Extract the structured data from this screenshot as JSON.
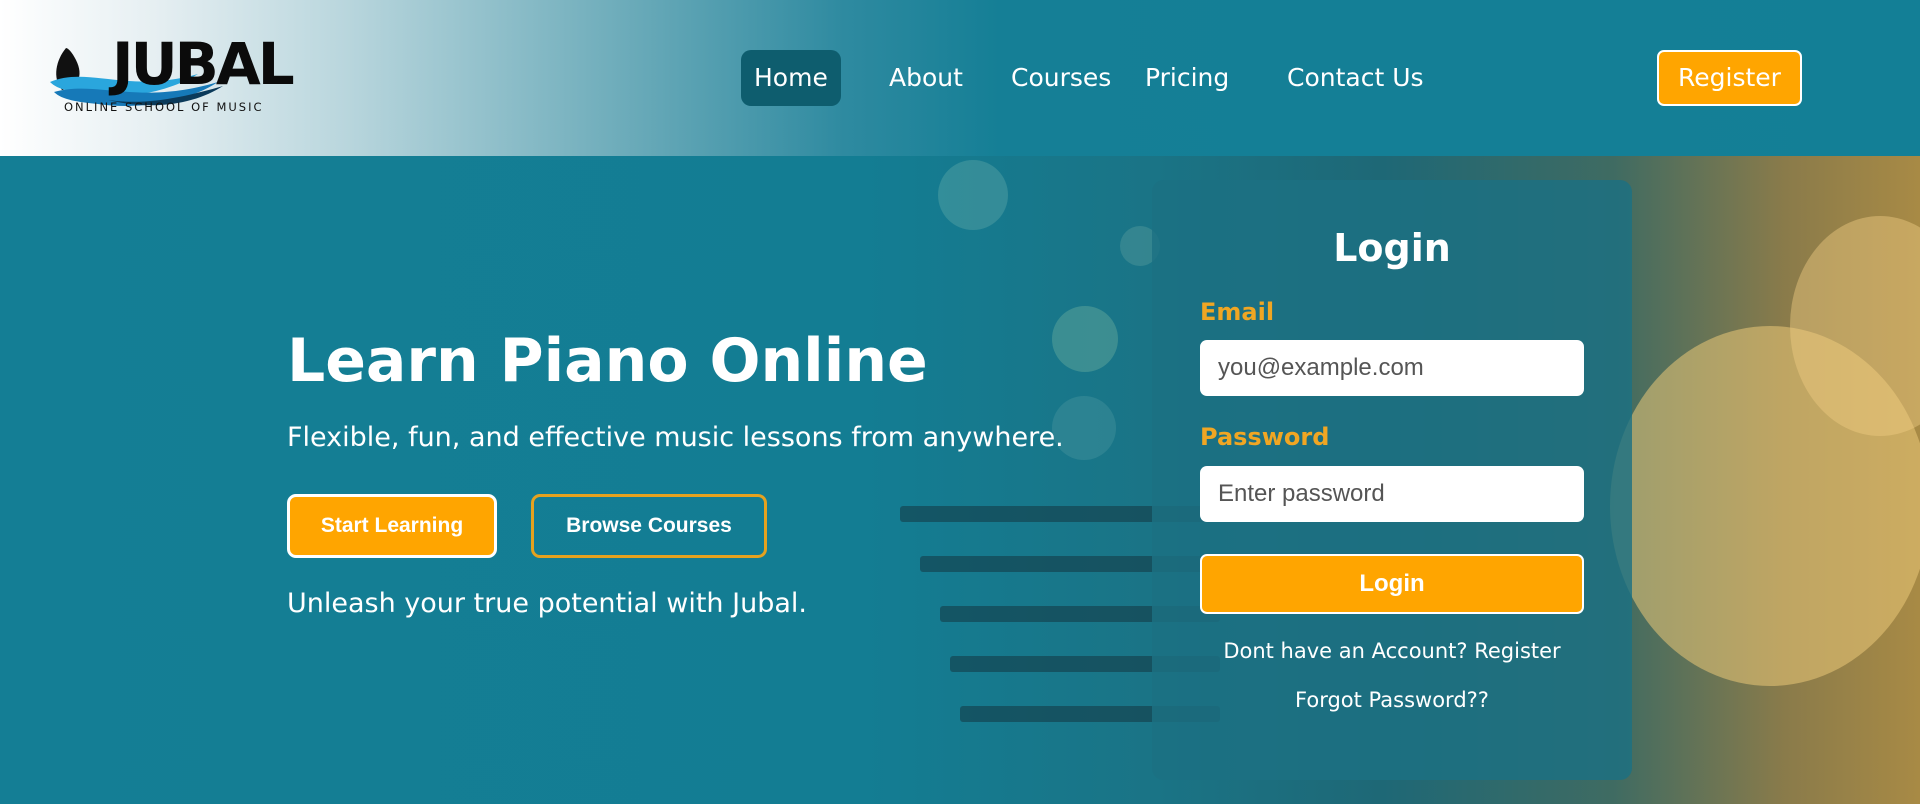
{
  "brand": {
    "name": "JUBAL",
    "tagline": "ONLINE SCHOOL OF MUSIC"
  },
  "nav": {
    "items": [
      {
        "label": "Home"
      },
      {
        "label": "About"
      },
      {
        "label": "Courses"
      },
      {
        "label": "Pricing"
      },
      {
        "label": "Contact Us"
      }
    ],
    "register_label": "Register"
  },
  "hero": {
    "title": "Learn Piano Online",
    "subtitle": "Flexible, fun, and effective music lessons from anywhere.",
    "start_label": "Start Learning",
    "browse_label": "Browse Courses",
    "tagline": "Unleash your true potential with Jubal."
  },
  "login": {
    "title": "Login",
    "email_label": "Email",
    "email_placeholder": "you@example.com",
    "password_label": "Password",
    "password_placeholder": "Enter password",
    "submit_label": "Login",
    "register_link": "Dont have an Account? Register",
    "forgot_link": "Forgot Password??"
  },
  "colors": {
    "primary_teal": "#137f96",
    "accent_orange": "#ffa500",
    "label_orange": "#f0a623",
    "active_nav": "#0e5d6e"
  },
  "icons": {
    "logo": "wave-logo-icon"
  }
}
